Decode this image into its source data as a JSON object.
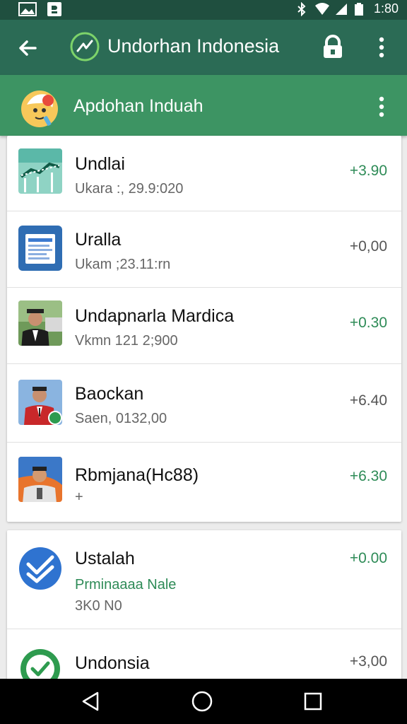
{
  "status_bar": {
    "time": "1:80",
    "icons": [
      "image-icon",
      "download-icon",
      "bluetooth-icon",
      "wifi-icon",
      "signal-icon",
      "battery-icon"
    ]
  },
  "app_bar": {
    "title": "Undorhan Indonesia",
    "icons": [
      "back-arrow-icon",
      "app-logo-icon",
      "lock-icon",
      "more-vert-icon"
    ]
  },
  "sub_bar": {
    "title": "Apdohan Induah",
    "icons": [
      "chat-avatar-icon",
      "more-vert-icon"
    ]
  },
  "list_primary": [
    {
      "name": "Undlai",
      "subtitle": "Ukara :, 29.9:020",
      "amount": "+3.90",
      "amount_color": "#2e8b57",
      "thumb": "chart-thumbnail"
    },
    {
      "name": "Uralla",
      "subtitle": "Ukam ;23.11:rn",
      "amount": "+0,00",
      "amount_color": "#555555",
      "thumb": "document-thumbnail"
    },
    {
      "name": "Undapnarla Mardica",
      "subtitle": "Vkmn 121 2;900",
      "amount": "+0.30",
      "amount_color": "#2e8b57",
      "thumb": "person-photo"
    },
    {
      "name": "Baockan",
      "subtitle": "Saen, 0132,00",
      "amount": "+6.40",
      "amount_color": "#555555",
      "thumb": "person-photo"
    },
    {
      "name": "Rbmjana(Hc88)",
      "subtitle": "+",
      "amount": "+6.30",
      "amount_color": "#2e8b57",
      "thumb": "person-photo"
    }
  ],
  "list_secondary": [
    {
      "name": "Ustalah",
      "subtitle": "Prminaaaa Nale",
      "detail": "3K0 N0",
      "amount": "+0.00",
      "amount_color": "#2e8b57",
      "thumb": "check-badge-icon"
    },
    {
      "name": "Undonsia",
      "amount": "+3,00",
      "amount_color": "#555555",
      "thumb": "check-circle-icon"
    }
  ],
  "nav_bar": {
    "icons": [
      "back-triangle-icon",
      "home-circle-icon",
      "recents-square-icon"
    ]
  }
}
